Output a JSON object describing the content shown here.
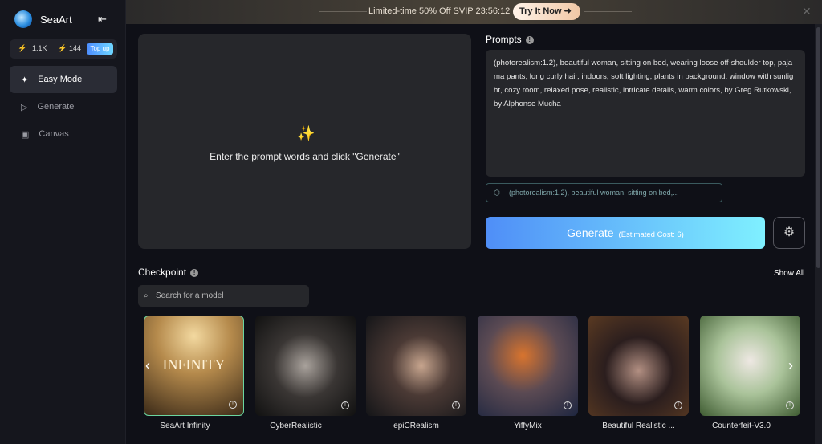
{
  "sidebar": {
    "brand": "SeaArt",
    "credits_a": "1.1K",
    "credits_b": "144",
    "topup": "Top up",
    "items": [
      {
        "label": "Easy Mode",
        "icon": "sparkle-icon"
      },
      {
        "label": "Generate",
        "icon": "play-icon"
      },
      {
        "label": "Canvas",
        "icon": "canvas-icon"
      }
    ]
  },
  "banner": {
    "text": "Limited-time 50% Off SVIP 23:56:12",
    "cta": "Try It Now"
  },
  "preview": {
    "hint": "Enter the prompt words and click \"Generate\""
  },
  "prompts": {
    "label": "Prompts",
    "value": "(photorealism:1.2), beautiful woman, sitting on bed, wearing loose off-shoulder top, pajama pants, long curly hair, indoors, soft lighting, plants in background, window with sunlight, cozy room, relaxed pose, realistic, intricate details, warm colors, by Greg Rutkowski, by Alphonse Mucha",
    "suggestion": "(photorealism:1.2), beautiful woman, sitting on bed,..."
  },
  "generate": {
    "label": "Generate",
    "cost": "(Estimated Cost: 6)"
  },
  "checkpoint": {
    "label": "Checkpoint",
    "show_all": "Show All",
    "search_placeholder": "Search for a model",
    "models": [
      {
        "name": "SeaArt Infinity",
        "overlay": "INFINITY"
      },
      {
        "name": "CyberRealistic"
      },
      {
        "name": "epiCRealism"
      },
      {
        "name": "YiffyMix"
      },
      {
        "name": "Beautiful Realistic ..."
      },
      {
        "name": "Counterfeit-V3.0"
      }
    ]
  },
  "colors": {
    "accent_start": "#4f8ef7",
    "accent_end": "#7ff0ff",
    "selected_border": "#6bd6a0"
  }
}
